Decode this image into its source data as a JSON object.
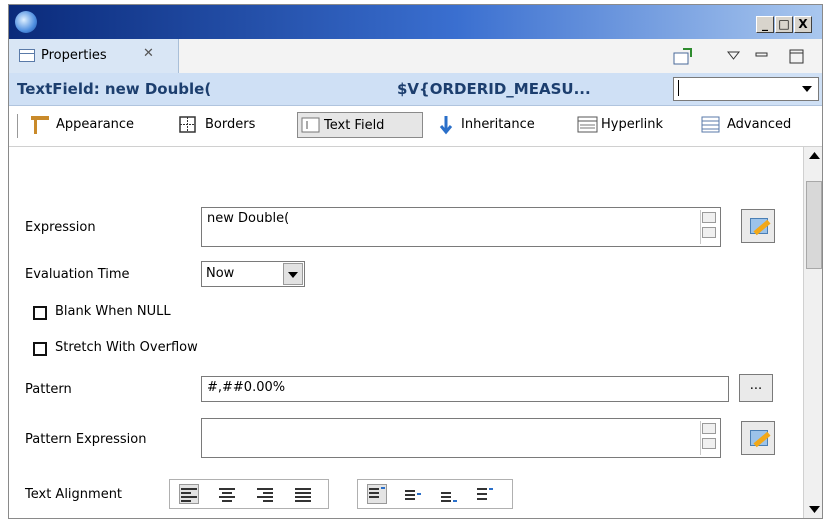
{
  "window": {
    "minimize_glyph": "_",
    "maximize_glyph": "□",
    "close_glyph": "X"
  },
  "view": {
    "tab_label": "Properties",
    "tab_close_glyph": "✕"
  },
  "header": {
    "title": "TextField: new Double(",
    "expression_preview": "$V{ORDERID_MEASU...",
    "combo_value": ""
  },
  "toolbar": {
    "items": [
      {
        "label": "Appearance",
        "icon": "appearance-icon"
      },
      {
        "label": "Borders",
        "icon": "borders-icon"
      },
      {
        "label": "Text Field",
        "icon": "text-field-icon",
        "active": true
      },
      {
        "label": "Inheritance",
        "icon": "inheritance-icon"
      },
      {
        "label": "Hyperlink",
        "icon": "hyperlink-icon"
      },
      {
        "label": "Advanced",
        "icon": "advanced-icon"
      }
    ]
  },
  "form": {
    "expression": {
      "label": "Expression",
      "value": "new Double("
    },
    "evaluation_time": {
      "label": "Evaluation Time",
      "value": "Now"
    },
    "blank_when_null": {
      "label": "Blank When NULL",
      "checked": false
    },
    "stretch_with_overflow": {
      "label": "Stretch With Overflow",
      "checked": false
    },
    "pattern": {
      "label": "Pattern",
      "value": "#,##0.00%",
      "button_label": "..."
    },
    "pattern_expression": {
      "label": "Pattern Expression",
      "value": ""
    },
    "text_alignment": {
      "label": "Text Alignment"
    }
  },
  "colors": {
    "header_bg": "#cfe0f5",
    "header_text": "#1c3e6e",
    "tab_bg": "#d9e6f5"
  }
}
